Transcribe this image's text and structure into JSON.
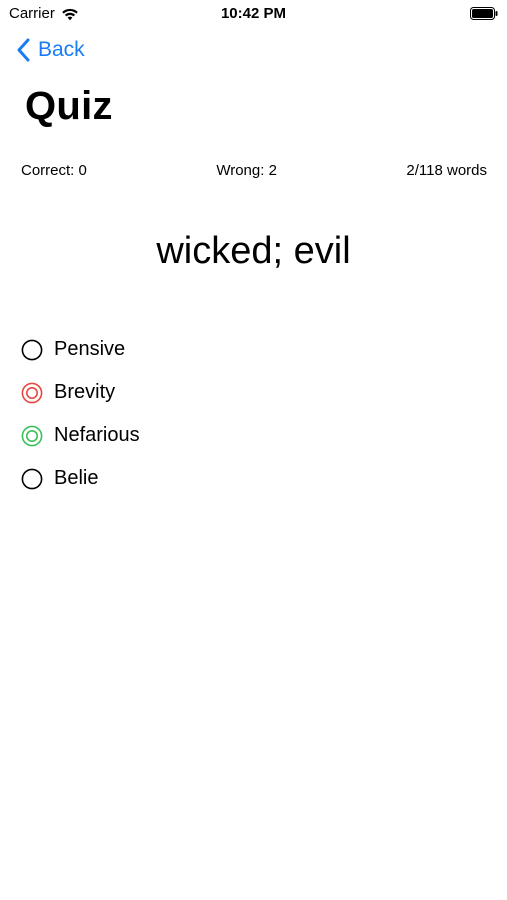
{
  "status_bar": {
    "carrier": "Carrier",
    "time": "10:42 PM",
    "icons": [
      "wifi-icon",
      "battery-icon"
    ]
  },
  "nav": {
    "back_label": "Back",
    "back_icon": "chevron-left-icon",
    "accent_color": "#1a7cf5"
  },
  "page": {
    "title": "Quiz"
  },
  "stats": {
    "correct": "Correct: 0",
    "wrong": "Wrong: 2",
    "progress": "2/118 words"
  },
  "question": {
    "definition": "wicked; evil"
  },
  "options": [
    {
      "label": "Pensive",
      "state": "unselected",
      "color": "#000000"
    },
    {
      "label": "Brevity",
      "state": "wrong",
      "color": "#e8473f"
    },
    {
      "label": "Nefarious",
      "state": "correct",
      "color": "#3cc05a"
    },
    {
      "label": "Belie",
      "state": "unselected",
      "color": "#000000"
    }
  ]
}
